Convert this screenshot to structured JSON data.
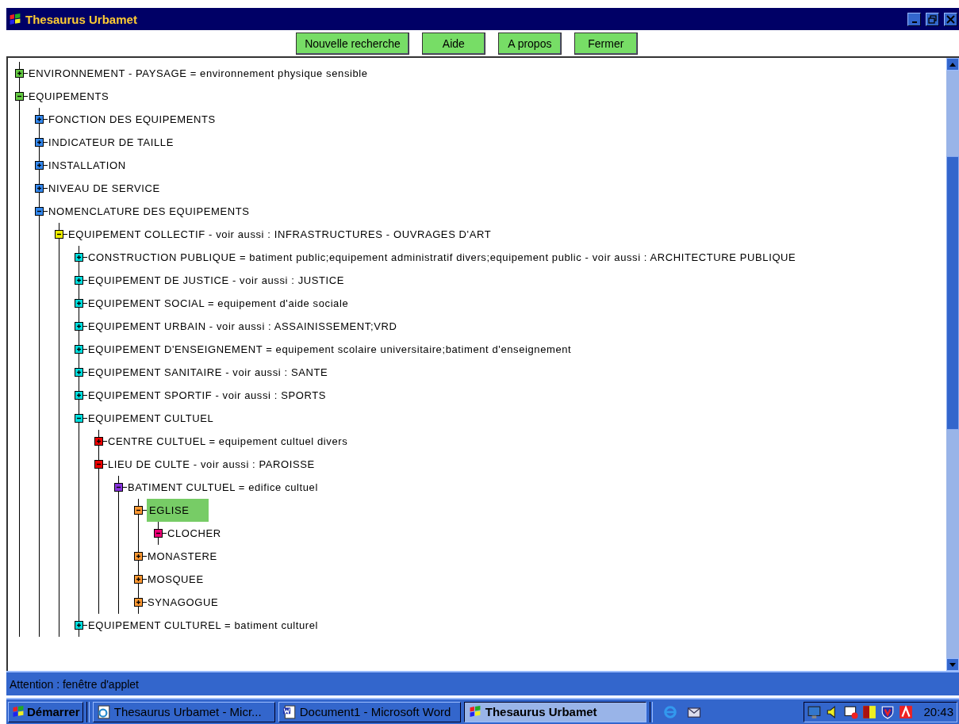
{
  "window": {
    "title": "Thesaurus Urbamet"
  },
  "toolbar": {
    "buttons": [
      "Nouvelle recherche",
      "Aide",
      "A propos",
      "Fermer"
    ]
  },
  "tree": [
    {
      "label": "ENVIRONNEMENT - PAYSAGE = environnement physique sensible",
      "expanded": false,
      "selected": false,
      "color": "#66cc44"
    },
    {
      "label": "EQUIPEMENTS",
      "expanded": true,
      "selected": false,
      "color": "#66cc44",
      "children": [
        {
          "label": "FONCTION DES EQUIPEMENTS",
          "expanded": false,
          "selected": false,
          "color": "#3388ee"
        },
        {
          "label": "INDICATEUR DE TAILLE",
          "expanded": false,
          "selected": false,
          "color": "#3388ee"
        },
        {
          "label": "INSTALLATION",
          "expanded": false,
          "selected": false,
          "color": "#3388ee"
        },
        {
          "label": "NIVEAU DE SERVICE",
          "expanded": false,
          "selected": false,
          "color": "#3388ee"
        },
        {
          "label": "NOMENCLATURE DES EQUIPEMENTS",
          "expanded": true,
          "selected": false,
          "color": "#3388ee",
          "children": [
            {
              "label": "EQUIPEMENT COLLECTIF - voir aussi : INFRASTRUCTURES - OUVRAGES D'ART",
              "expanded": true,
              "selected": false,
              "color": "#eeee00",
              "children": [
                {
                  "label": "CONSTRUCTION PUBLIQUE = batiment public;equipement administratif divers;equipement public - voir aussi : ARCHITECTURE PUBLIQUE",
                  "expanded": false,
                  "selected": false,
                  "color": "#00dddd"
                },
                {
                  "label": "EQUIPEMENT DE JUSTICE - voir aussi : JUSTICE",
                  "expanded": false,
                  "selected": false,
                  "color": "#00dddd"
                },
                {
                  "label": "EQUIPEMENT SOCIAL = equipement d'aide sociale",
                  "expanded": false,
                  "selected": false,
                  "color": "#00dddd"
                },
                {
                  "label": "EQUIPEMENT URBAIN - voir aussi : ASSAINISSEMENT;VRD",
                  "expanded": false,
                  "selected": false,
                  "color": "#00dddd"
                },
                {
                  "label": "EQUIPEMENT D'ENSEIGNEMENT = equipement scolaire universitaire;batiment d'enseignement",
                  "expanded": false,
                  "selected": false,
                  "color": "#00dddd"
                },
                {
                  "label": "EQUIPEMENT SANITAIRE - voir aussi : SANTE",
                  "expanded": false,
                  "selected": false,
                  "color": "#00dddd"
                },
                {
                  "label": "EQUIPEMENT SPORTIF - voir aussi : SPORTS",
                  "expanded": false,
                  "selected": false,
                  "color": "#00dddd"
                },
                {
                  "label": "EQUIPEMENT CULTUEL",
                  "expanded": true,
                  "selected": false,
                  "color": "#00dddd",
                  "children": [
                    {
                      "label": "CENTRE CULTUEL = equipement cultuel divers",
                      "expanded": false,
                      "selected": false,
                      "color": "#ee0000"
                    },
                    {
                      "label": "LIEU DE CULTE - voir aussi : PAROISSE",
                      "expanded": true,
                      "selected": false,
                      "color": "#ee0000",
                      "children": [
                        {
                          "label": "BATIMENT CULTUEL = edifice cultuel",
                          "expanded": true,
                          "selected": false,
                          "color": "#8833dd",
                          "children": [
                            {
                              "label": "EGLISE",
                              "expanded": true,
                              "selected": true,
                              "color": "#ff9933",
                              "children": [
                                {
                                  "label": "CLOCHER",
                                  "expanded": true,
                                  "selected": false,
                                  "color": "#ee0077"
                                }
                              ]
                            },
                            {
                              "label": "MONASTERE",
                              "expanded": false,
                              "selected": false,
                              "color": "#ff9933"
                            },
                            {
                              "label": "MOSQUEE",
                              "expanded": false,
                              "selected": false,
                              "color": "#ff9933"
                            },
                            {
                              "label": "SYNAGOGUE",
                              "expanded": false,
                              "selected": false,
                              "color": "#ff9933"
                            }
                          ]
                        }
                      ]
                    }
                  ]
                },
                {
                  "label": "EQUIPEMENT CULTUREL = batiment culturel",
                  "expanded": false,
                  "selected": false,
                  "color": "#00dddd"
                }
              ]
            }
          ]
        }
      ]
    }
  ],
  "status_bar": "Attention : fenêtre d'applet",
  "taskbar": {
    "start": "Démarrer",
    "tasks": [
      {
        "label": "Thesaurus Urbamet - Micr...",
        "kind": "browser",
        "selected": false
      },
      {
        "label": "Document1 - Microsoft Word",
        "kind": "word",
        "selected": false
      },
      {
        "label": "Thesaurus Urbamet",
        "kind": "app",
        "selected": true
      }
    ],
    "clock": "20:43"
  }
}
